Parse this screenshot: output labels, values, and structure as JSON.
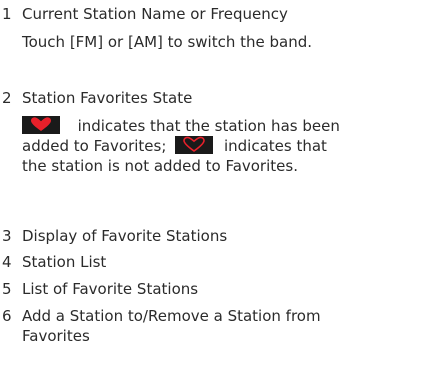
{
  "items": [
    {
      "number": "1",
      "title": "Current Station Name or Frequency",
      "detail": "Touch [FM] or [AM] to switch the band."
    },
    {
      "number": "2",
      "title": "Station Favorites State",
      "detail_line1_suffix": "indicates that the station has been",
      "detail_line2_prefix": "added to Favorites;",
      "detail_line2_suffix": "indicates that",
      "detail_line3": "the station is not added to Favorites."
    },
    {
      "number": "3",
      "title": "Display of Favorite Stations"
    },
    {
      "number": "4",
      "title": "Station List"
    },
    {
      "number": "5",
      "title": "List of Favorite Stations"
    },
    {
      "number": "6",
      "title_line1": "Add a Station to/Remove a Station from",
      "title_line2": "Favorites"
    }
  ],
  "icons": {
    "favorite_filled": "heart-filled-icon",
    "favorite_outline": "heart-outline-icon",
    "accent_color": "#e8202a",
    "icon_background": "#1a1a1a"
  }
}
